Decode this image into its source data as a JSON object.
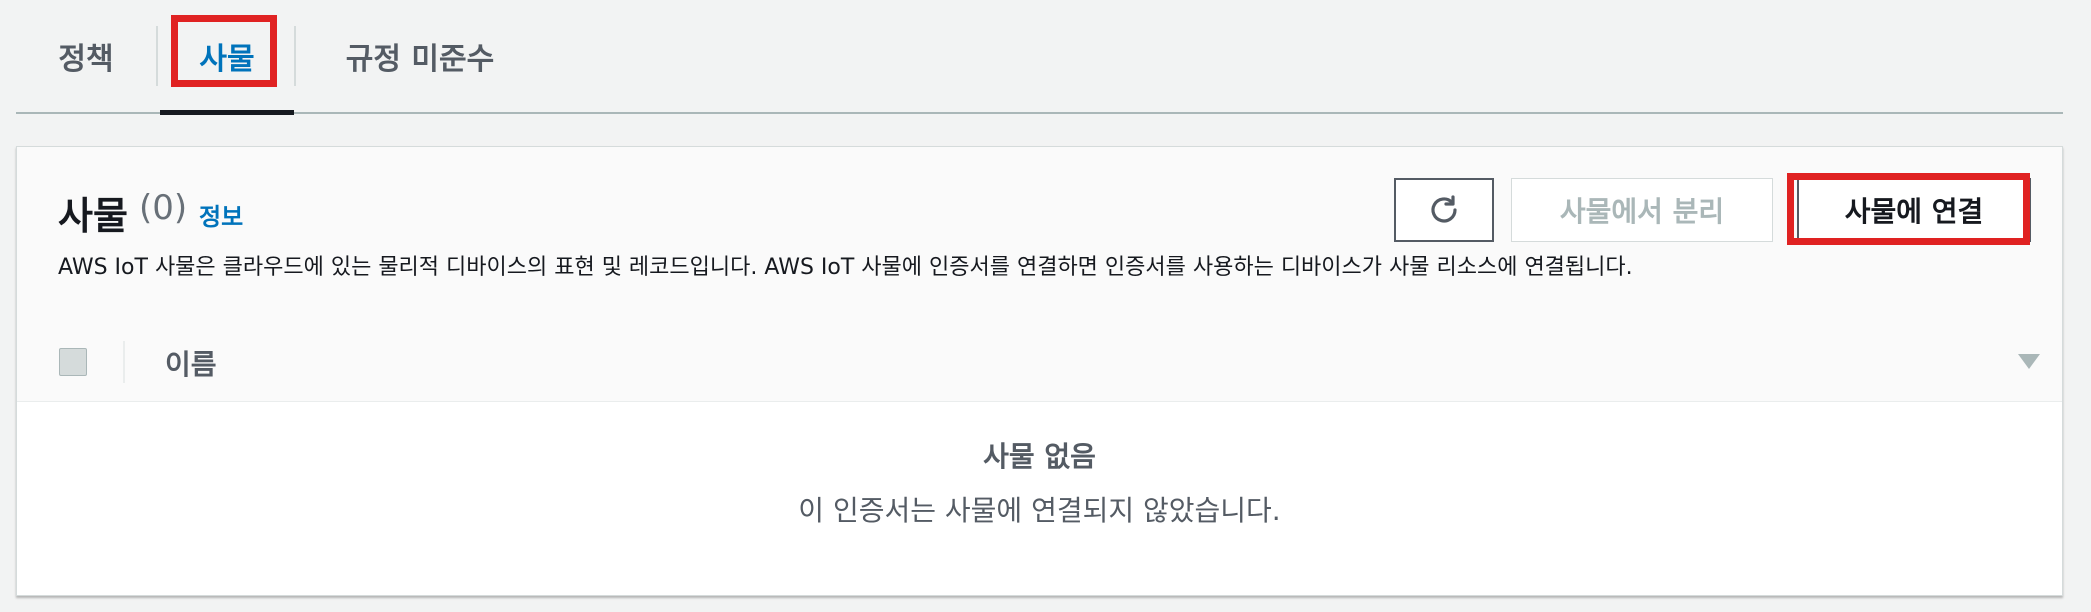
{
  "tabs": [
    {
      "label": "정책"
    },
    {
      "label": "사물"
    },
    {
      "label": "규정 미준수"
    }
  ],
  "panel": {
    "title": "사물",
    "count": "(0)",
    "info_link": "정보",
    "description": "AWS IoT 사물은 클라우드에 있는 물리적 디바이스의 표현 및 레코드입니다. AWS IoT 사물에 인증서를 연결하면 인증서를 사용하는 디바이스가 사물 리소스에 연결됩니다.",
    "buttons": {
      "refresh_icon": "refresh-icon",
      "detach": "사물에서 분리",
      "attach": "사물에 연결"
    }
  },
  "table": {
    "columns": [
      "이름"
    ],
    "empty_title": "사물 없음",
    "empty_message": "이 인증서는 사물에 연결되지 않았습니다."
  },
  "colors": {
    "accent": "#0073bb",
    "highlight": "#e02222"
  }
}
